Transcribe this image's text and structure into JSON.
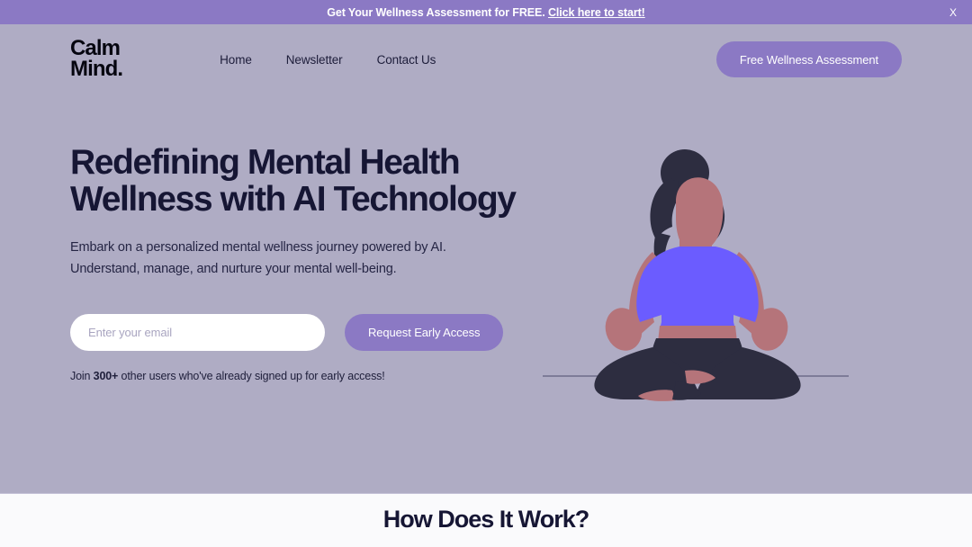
{
  "banner": {
    "text": "Get Your Wellness Assessment for FREE.",
    "link_label": "Click here to start!",
    "close_label": "X",
    "background_color": "#8b79c4",
    "text_color": "#ffffff"
  },
  "header": {
    "logo": "Calm\nMind.",
    "nav": [
      {
        "label": "Home"
      },
      {
        "label": "Newsletter"
      },
      {
        "label": "Contact Us"
      }
    ],
    "cta_label": "Free Wellness Assessment"
  },
  "hero": {
    "title": "Redefining Mental Health\nWellness with AI Technology",
    "subtitle": "Embark on a personalized mental wellness journey powered by AI.\nUnderstand, manage, and nurture your mental well-being.",
    "background_color": "#afacc4",
    "title_color": "#161634",
    "form": {
      "email_placeholder": "Enter your email",
      "email_value": "",
      "submit_label": "Request Early Access"
    },
    "social_proof": {
      "prefix": "Join ",
      "count": "300+",
      "suffix": " other users who've already signed up for early access!"
    },
    "illustration": {
      "name": "meditating-woman-lotus-pose",
      "colors": {
        "hair": "#2d2d40",
        "skin": "#b5747a",
        "top": "#6b5cff",
        "pants": "#2d2d40",
        "ground_line": "#6f6c8a"
      }
    }
  },
  "how_section": {
    "title": "How Does It Work?",
    "background_color": "#fafafc"
  },
  "accent_color": "#8b79c4"
}
